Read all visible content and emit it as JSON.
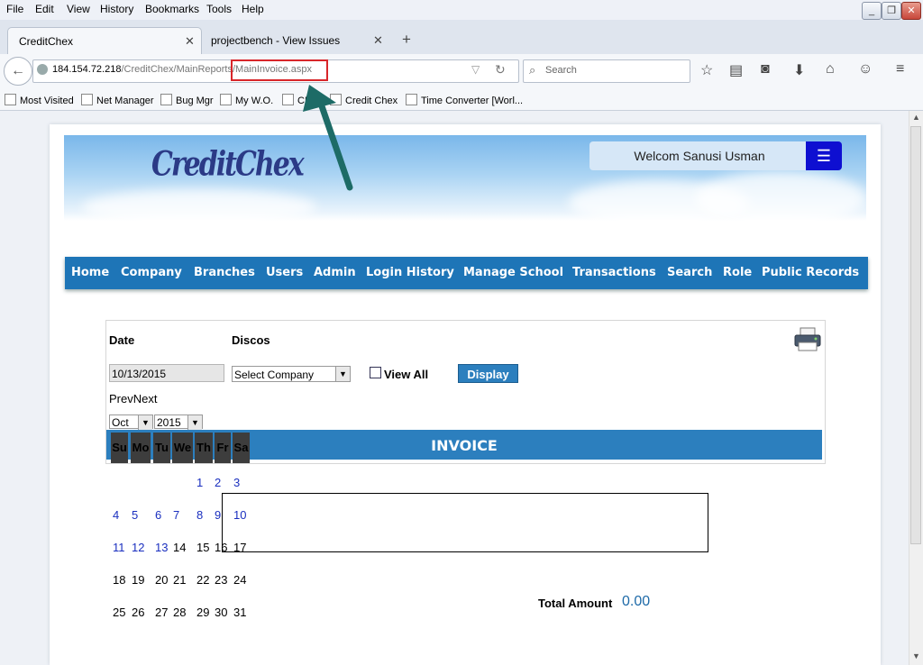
{
  "menubar": {
    "items": [
      "File",
      "Edit",
      "View",
      "History",
      "Bookmarks",
      "Tools",
      "Help"
    ]
  },
  "tabs": [
    {
      "label": "CreditChex"
    },
    {
      "label": "projectbench - View Issues"
    }
  ],
  "address": {
    "host": "184.154.72.218",
    "path": "/CreditChex/MainReports/",
    "file": "MainInvoice.aspx"
  },
  "search": {
    "placeholder": "Search"
  },
  "bookmarks": [
    "Most Visited",
    "Net Manager",
    "Bug Mgr",
    "My W.O.",
    "CB...",
    "Credit Chex",
    "Time Converter [Worl..."
  ],
  "app": {
    "logo_text": "CreditChex",
    "welcome": "Welcom Sanusi Usman",
    "nav": [
      "Home",
      "Company",
      "Branches",
      "Users",
      "Admin",
      "Login History",
      "Manage School",
      "Transactions",
      "Search",
      "Role",
      "Public Records"
    ]
  },
  "form": {
    "date_label": "Date",
    "discos_label": "Discos",
    "date_value": "10/13/2015",
    "company_select": "Select Company",
    "view_all_label": "View All",
    "display_button": "Display",
    "prevnext": "PrevNext",
    "month": "Oct",
    "year": "2015"
  },
  "invoice": {
    "title": "INVOICE",
    "total_label": "Total Amount",
    "total_value": "0.00"
  },
  "calendar": {
    "day_headers": [
      "Su",
      "Mo",
      "Tu",
      "We",
      "Th",
      "Fr",
      "Sa"
    ],
    "weeks": [
      [
        "",
        "",
        "",
        "",
        "1",
        "2",
        "3"
      ],
      [
        "4",
        "5",
        "6",
        "7",
        "8",
        "9",
        "10"
      ],
      [
        "11",
        "12",
        "13",
        "14",
        "15",
        "16",
        "17"
      ],
      [
        "18",
        "19",
        "20",
        "21",
        "22",
        "23",
        "24"
      ],
      [
        "25",
        "26",
        "27",
        "28",
        "29",
        "30",
        "31"
      ]
    ]
  },
  "colors": {
    "nav_bg": "#1e75b7",
    "annotation_arrow": "#1d6b66",
    "highlight": "#d8262a"
  }
}
